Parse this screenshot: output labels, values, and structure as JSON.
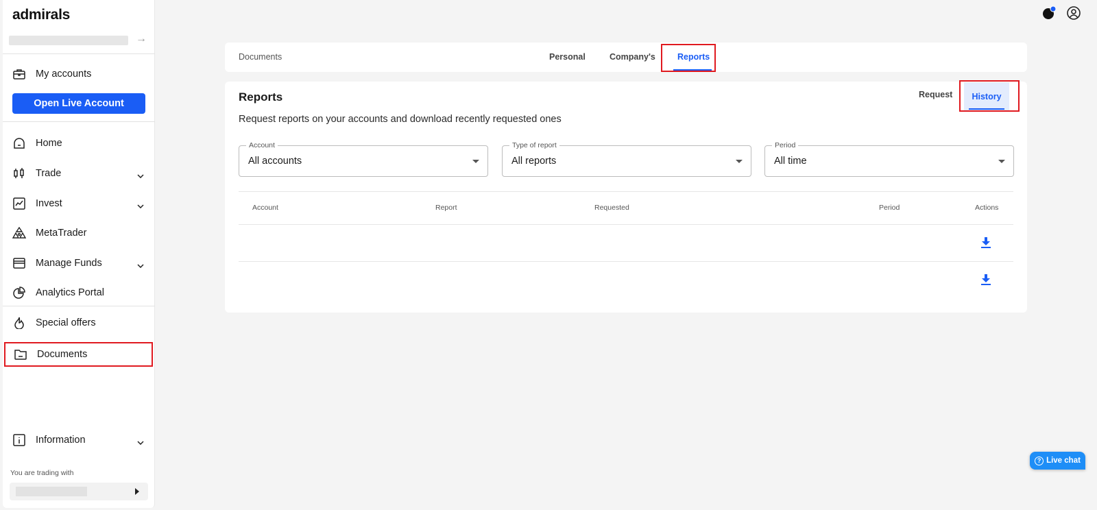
{
  "sidebar": {
    "logo_text": "admirals",
    "items": {
      "my_accounts": "My accounts",
      "open_live": "Open Live Account",
      "home": "Home",
      "trade": "Trade",
      "invest": "Invest",
      "metatrader": "MetaTrader",
      "manage_funds": "Manage Funds",
      "analytics": "Analytics Portal",
      "special_offers": "Special offers",
      "documents": "Documents",
      "information": "Information"
    },
    "trading_with_label": "You are trading with"
  },
  "tabs": {
    "section_title": "Documents",
    "personal": "Personal",
    "company": "Company's",
    "reports": "Reports",
    "active": "Reports"
  },
  "reports": {
    "title": "Reports",
    "subtitle": "Request reports on your accounts and download recently requested ones",
    "segment_request": "Request",
    "segment_history": "History",
    "filters": {
      "account": {
        "label": "Account",
        "value": "All accounts"
      },
      "type": {
        "label": "Type of report",
        "value": "All reports"
      },
      "period": {
        "label": "Period",
        "value": "All time"
      }
    },
    "table": {
      "headers": {
        "account": "Account",
        "report": "Report",
        "requested": "Requested",
        "period": "Period",
        "actions": "Actions"
      },
      "rows": [
        {
          "account": "",
          "report": "",
          "requested": "",
          "period": "",
          "action_icon": "download-icon"
        },
        {
          "account": "",
          "report": "",
          "requested": "",
          "period": "",
          "action_icon": "download-icon"
        }
      ]
    }
  },
  "live_chat_label": "Live chat",
  "colors": {
    "accent": "#1a5df5",
    "highlight": "#e0191f",
    "chat": "#1e8ef7"
  }
}
